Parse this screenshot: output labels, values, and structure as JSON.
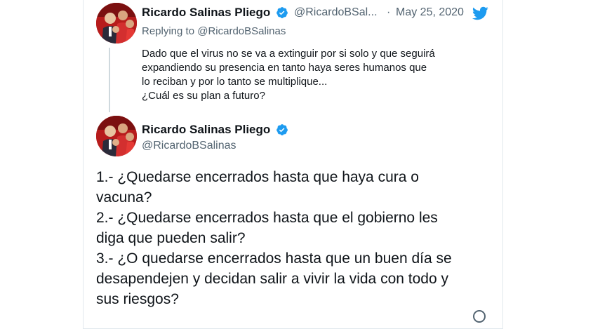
{
  "reply_tweet": {
    "author_name": "Ricardo Salinas Pliego",
    "handle": "@RicardoBSal...",
    "separator": "·",
    "date": "May 25, 2020",
    "replying_prefix": "Replying to",
    "replying_handle": "@RicardoBSalinas",
    "lines": [
      "Dado que el virus no se va a extinguir por si solo y que seguirá",
      "expandiendo su presencia en tanto haya seres humanos que",
      "lo reciban y por lo tanto se multiplique...",
      "¿Cuál es su plan a futuro?"
    ]
  },
  "main_tweet": {
    "author_name": "Ricardo Salinas Pliego",
    "handle": "@RicardoBSalinas",
    "lines": [
      "1.- ¿Quedarse encerrados hasta que haya cura o",
      "vacuna?",
      "2.- ¿Quedarse encerrados hasta que el gobierno les",
      "diga que pueden salir?",
      "3.- ¿O quedarse encerrados hasta que un buen día se",
      "desapendejen y decidan salir a vivir la vida con todo y",
      "sus riesgos?"
    ]
  },
  "colors": {
    "verified": "#1d9bf0",
    "twitter_bird": "#1d9bf0",
    "secondary_text": "#536471"
  }
}
